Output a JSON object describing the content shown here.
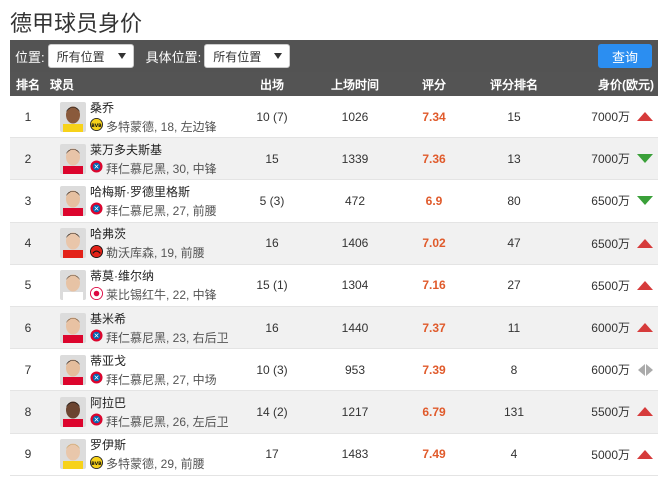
{
  "page": {
    "title": "德甲球员身价"
  },
  "filters": {
    "position_label": "位置:",
    "position_value": "所有位置",
    "detail_label": "具体位置:",
    "detail_value": "所有位置",
    "query_label": "查询"
  },
  "table": {
    "headers": {
      "rank": "排名",
      "player": "球员",
      "apps": "出场",
      "minutes": "上场时间",
      "rating": "评分",
      "rating_rank": "评分排名",
      "value": "身价(欧元)"
    },
    "rows": [
      {
        "rank": "1",
        "name": "桑乔",
        "team_info": "多特蒙德, 18, 左边锋",
        "club": "dortmund",
        "apps": "10 (7)",
        "minutes": "1026",
        "rating": "7.34",
        "rating_rank": "15",
        "value": "7000万",
        "trend": "up"
      },
      {
        "rank": "2",
        "name": "莱万多夫斯基",
        "team_info": "拜仁慕尼黑, 30, 中锋",
        "club": "bayern",
        "apps": "15",
        "minutes": "1339",
        "rating": "7.36",
        "rating_rank": "13",
        "value": "7000万",
        "trend": "down"
      },
      {
        "rank": "3",
        "name": "哈梅斯·罗德里格斯",
        "team_info": "拜仁慕尼黑, 27, 前腰",
        "club": "bayern",
        "apps": "5 (3)",
        "minutes": "472",
        "rating": "6.9",
        "rating_rank": "80",
        "value": "6500万",
        "trend": "down"
      },
      {
        "rank": "4",
        "name": "哈弗茨",
        "team_info": "勒沃库森, 19, 前腰",
        "club": "leverkusen",
        "apps": "16",
        "minutes": "1406",
        "rating": "7.02",
        "rating_rank": "47",
        "value": "6500万",
        "trend": "up"
      },
      {
        "rank": "5",
        "name": "蒂莫·维尔纳",
        "team_info": "莱比锡红牛, 22, 中锋",
        "club": "leipzig",
        "apps": "15 (1)",
        "minutes": "1304",
        "rating": "7.16",
        "rating_rank": "27",
        "value": "6500万",
        "trend": "up"
      },
      {
        "rank": "6",
        "name": "基米希",
        "team_info": "拜仁慕尼黑, 23, 右后卫",
        "club": "bayern",
        "apps": "16",
        "minutes": "1440",
        "rating": "7.37",
        "rating_rank": "11",
        "value": "6000万",
        "trend": "up"
      },
      {
        "rank": "7",
        "name": "蒂亚戈",
        "team_info": "拜仁慕尼黑, 27, 中场",
        "club": "bayern",
        "apps": "10 (3)",
        "minutes": "953",
        "rating": "7.39",
        "rating_rank": "8",
        "value": "6000万",
        "trend": "flat"
      },
      {
        "rank": "8",
        "name": "阿拉巴",
        "team_info": "拜仁慕尼黑, 26, 左后卫",
        "club": "bayern",
        "apps": "14 (2)",
        "minutes": "1217",
        "rating": "6.79",
        "rating_rank": "131",
        "value": "5500万",
        "trend": "up"
      },
      {
        "rank": "9",
        "name": "罗伊斯",
        "team_info": "多特蒙德, 29, 前腰",
        "club": "dortmund",
        "apps": "17",
        "minutes": "1483",
        "rating": "7.49",
        "rating_rank": "4",
        "value": "5000万",
        "trend": "up"
      }
    ]
  },
  "colors": {
    "header_bg": "#545454",
    "filter_bg": "#535353",
    "query_btn": "#2b8ef1",
    "rating_text": "#e05a2b",
    "trend_up": "#d63b3b",
    "trend_down": "#3aa039",
    "trend_flat": "#aaaaaa",
    "row_alt": "#f1f1f1"
  },
  "icons": {
    "trend_up": "red-up-triangle-icon",
    "trend_down": "green-down-triangle-icon",
    "trend_flat": "gray-left-right-arrows-icon",
    "dropdown": "chevron-down-icon"
  }
}
